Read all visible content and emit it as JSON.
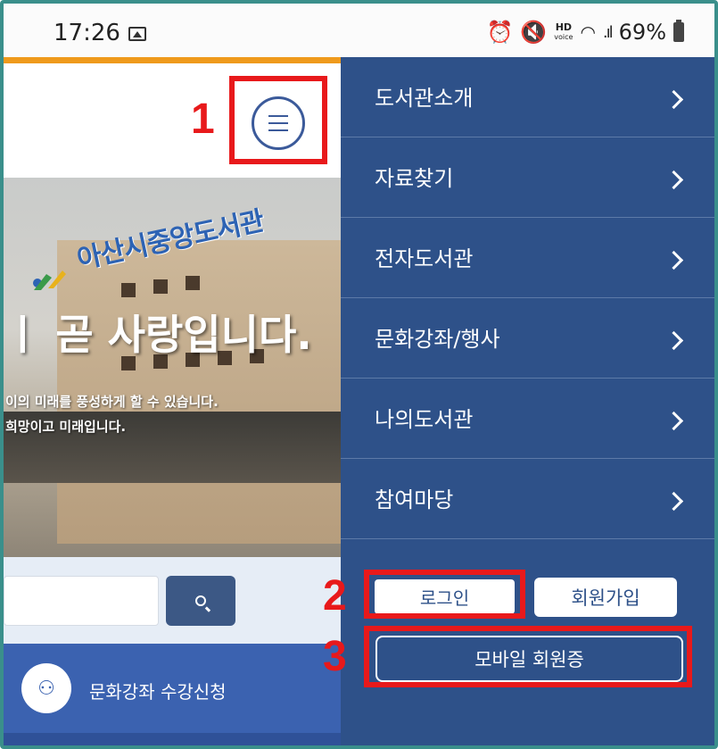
{
  "status_bar": {
    "time": "17:26",
    "hd_label": "HD",
    "voice_label": "voice",
    "battery": "69%"
  },
  "hero": {
    "sign_text": "아산시중앙도서관",
    "title": "ㅣ 곧 사랑입니다.",
    "subtitle_line1": "이의 미래를 풍성하게 할 수 있습니다.",
    "subtitle_line2": "희망이고 미래입니다."
  },
  "quick_link": {
    "label": "문화강좌 수강신청",
    "icon": "lecture-icon"
  },
  "side_menu": {
    "items": [
      {
        "label": "도서관소개"
      },
      {
        "label": "자료찾기"
      },
      {
        "label": "전자도서관"
      },
      {
        "label": "문화강좌/행사"
      },
      {
        "label": "나의도서관"
      },
      {
        "label": "참여마당"
      }
    ],
    "login_label": "로그인",
    "join_label": "회원가입",
    "mobile_card_label": "모바일 회원증"
  },
  "annotations": {
    "n1": "1",
    "n2": "2",
    "n3": "3"
  },
  "colors": {
    "menu_bg": "#2e5189",
    "highlight": "#e8191b",
    "accent_orange": "#ef9a1c",
    "quick_link_bg": "#3b62b0"
  }
}
